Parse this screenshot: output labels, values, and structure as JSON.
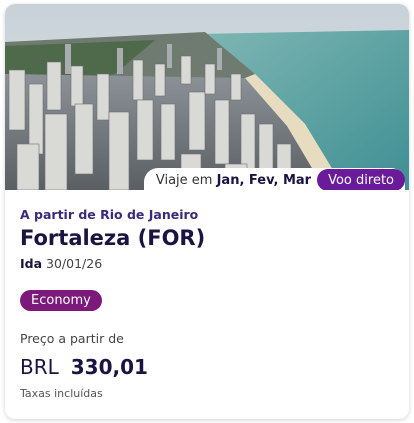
{
  "hero": {
    "image": "city-skyline-beach-photo",
    "months_prefix": "Viaje em",
    "months_list": "Jan, Fev, Mar",
    "badge": "Voo direto"
  },
  "flight": {
    "origin": "A partir de Rio de Janeiro",
    "destination": "Fortaleza (FOR)",
    "date_label": "Ida",
    "date_value": "30/01/26",
    "fare_class": "Economy"
  },
  "price": {
    "label": "Preço a partir de",
    "currency": "BRL",
    "amount": "330,01",
    "taxes": "Taxas incluídas"
  },
  "colors": {
    "accent": "#6a1b9a",
    "fare_badge": "#7b1a7a",
    "title": "#1a1440"
  }
}
